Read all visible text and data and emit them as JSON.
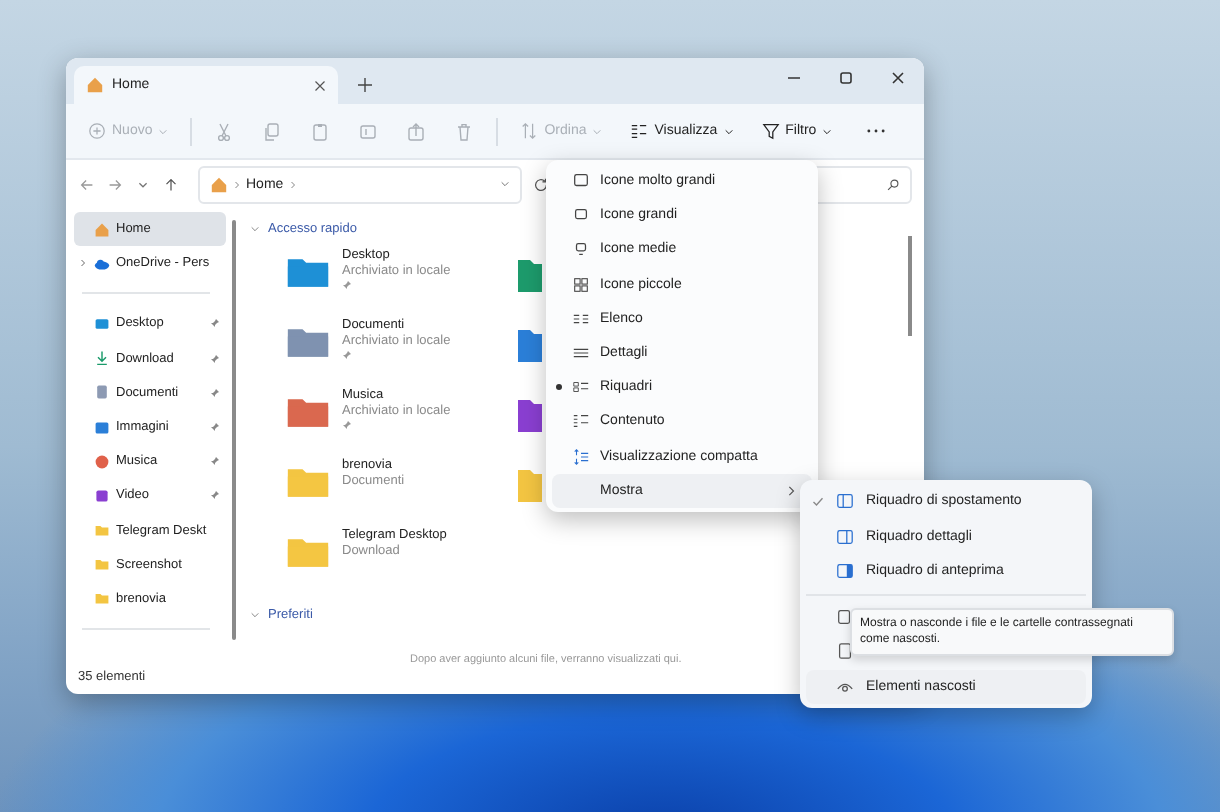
{
  "window": {
    "tab": {
      "title": "Home",
      "selected": true
    },
    "toolbar": {
      "new": {
        "label": "Nuovo",
        "disabled": true
      },
      "actions": [
        {
          "kind": "cut",
          "disabled": true
        },
        {
          "kind": "copy",
          "disabled": true
        },
        {
          "kind": "paste",
          "disabled": true
        },
        {
          "kind": "rename",
          "disabled": true
        },
        {
          "kind": "share",
          "disabled": true
        },
        {
          "kind": "delete",
          "disabled": true
        }
      ],
      "menus": [
        {
          "kind": "sort",
          "label": "Ordina",
          "disabled": true
        },
        {
          "kind": "view",
          "label": "Visualizza",
          "disabled": false
        },
        {
          "kind": "filter",
          "label": "Filtro",
          "disabled": false
        }
      ]
    },
    "address": {
      "path": "Home"
    },
    "sidebar": {
      "top_items": [
        {
          "kind": "home",
          "label": "Home",
          "selected": true,
          "expandable": false
        },
        {
          "kind": "cloud",
          "label": "OneDrive - Pers",
          "selected": false,
          "expandable": true
        }
      ],
      "pinned_items": [
        {
          "kind": "desktop",
          "label": "Desktop",
          "selected": false,
          "pinned": true
        },
        {
          "kind": "download",
          "label": "Download",
          "selected": false,
          "pinned": true
        },
        {
          "kind": "documents",
          "label": "Documenti",
          "selected": false,
          "pinned": true
        },
        {
          "kind": "pictures",
          "label": "Immagini",
          "selected": false,
          "pinned": true
        },
        {
          "kind": "music",
          "label": "Musica",
          "selected": false,
          "pinned": true
        },
        {
          "kind": "video",
          "label": "Video",
          "selected": false,
          "pinned": true
        },
        {
          "kind": "folder",
          "label": "Telegram Deskt",
          "selected": false,
          "pinned": false
        },
        {
          "kind": "folder",
          "label": "Screenshot",
          "selected": false,
          "pinned": false
        },
        {
          "kind": "folder",
          "label": "brenovia",
          "selected": false,
          "pinned": false
        }
      ]
    },
    "quick_access": {
      "title": "Accesso rapido",
      "expanded": true,
      "items": [
        {
          "kind": "desktop",
          "name": "Desktop",
          "subtitle": "Archiviato in locale",
          "pinned": true
        },
        {
          "kind": "documents",
          "name": "Documenti",
          "subtitle": "Archiviato in locale",
          "pinned": true
        },
        {
          "kind": "music",
          "name": "Musica",
          "subtitle": "Archiviato in locale",
          "pinned": true
        },
        {
          "kind": "folder",
          "name": "brenovia",
          "subtitle": "Documenti",
          "pinned": false
        },
        {
          "kind": "folder",
          "name": "Telegram Desktop",
          "subtitle": "Download",
          "pinned": false
        }
      ],
      "covered_items": [
        {
          "kind": "sheet"
        },
        {
          "kind": "pictures"
        },
        {
          "kind": "video"
        },
        {
          "kind": "folder"
        }
      ]
    },
    "favorites": {
      "title": "Preferiti",
      "expanded": true,
      "empty_text": "Dopo aver aggiunto alcuni file, verranno visualizzati qui."
    },
    "status_bar": "35 elementi"
  },
  "view_menu": {
    "items": [
      {
        "kind": "xlarge",
        "label": "Icone molto grandi",
        "selected": false
      },
      {
        "kind": "large",
        "label": "Icone grandi",
        "selected": false
      },
      {
        "kind": "medium",
        "label": "Icone medie",
        "selected": false
      },
      {
        "kind": "small",
        "label": "Icone piccole",
        "selected": false
      },
      {
        "kind": "list",
        "label": "Elenco",
        "selected": false
      },
      {
        "kind": "details",
        "label": "Dettagli",
        "selected": false
      },
      {
        "kind": "tiles",
        "label": "Riquadri",
        "selected": true
      },
      {
        "kind": "content",
        "label": "Contenuto",
        "selected": false
      },
      {
        "kind": "compact",
        "label": "Visualizzazione compatta",
        "selected": false
      },
      {
        "kind": "submenu",
        "label": "Mostra",
        "selected": false
      }
    ]
  },
  "show_menu": {
    "items": [
      {
        "kind": "nav",
        "label": "Riquadro di spostamento",
        "checked": true
      },
      {
        "kind": "details",
        "label": "Riquadro dettagli",
        "checked": false
      },
      {
        "kind": "preview",
        "label": "Riquadro di anteprima",
        "checked": false
      },
      {
        "kind": "checkboxes",
        "checked": false
      },
      {
        "kind": "extensions",
        "checked": false
      },
      {
        "kind": "hidden",
        "label": "Elementi nascosti",
        "checked": false
      }
    ]
  },
  "tooltip": "Mostra o nasconde i file e le cartelle contrassegnati come nascosti."
}
